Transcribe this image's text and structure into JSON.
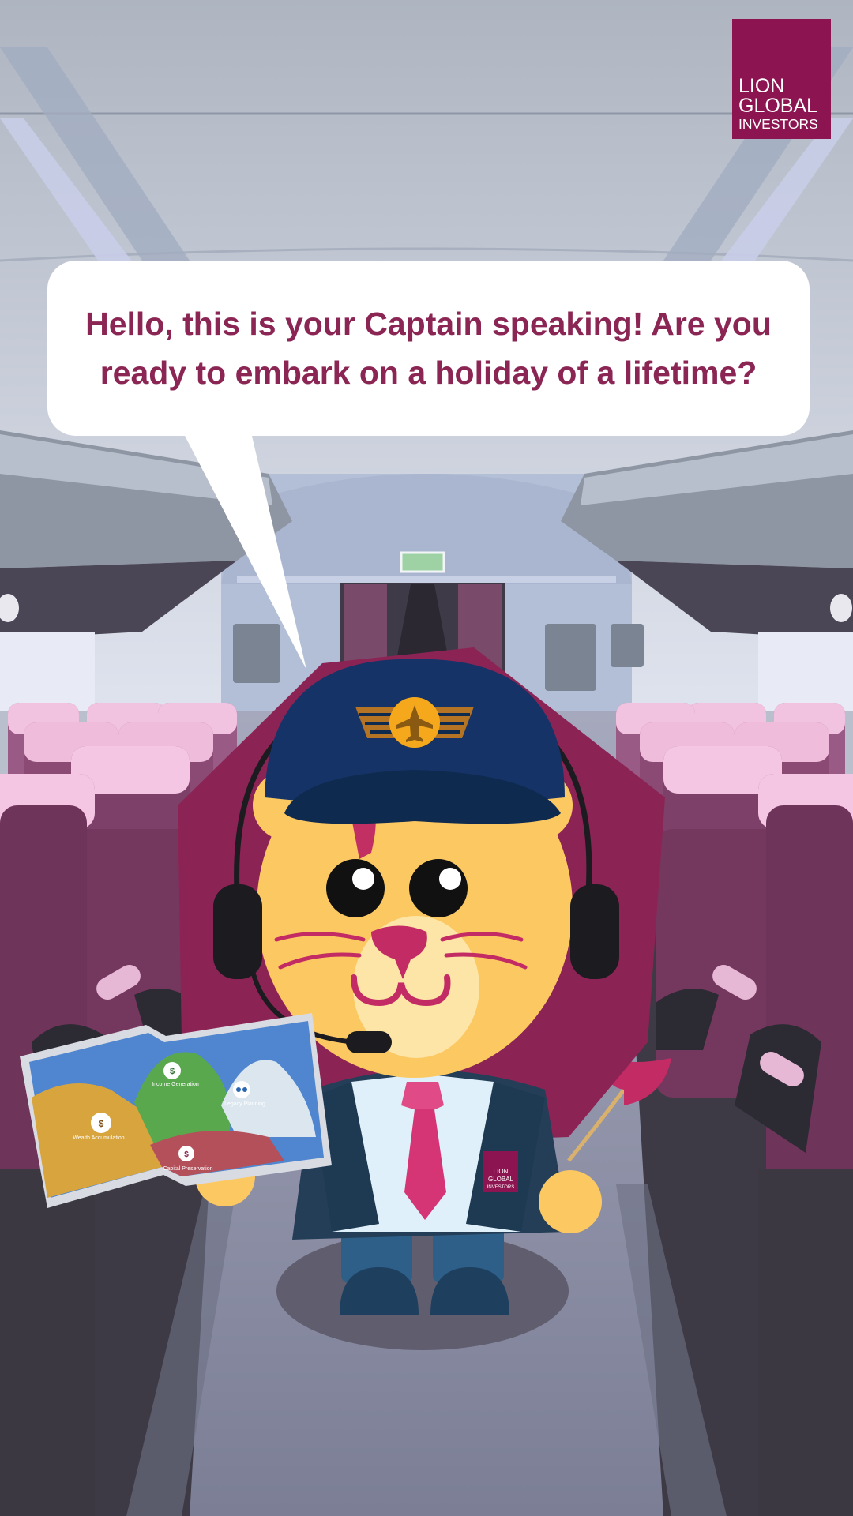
{
  "speech_bubble": {
    "text": "Hello, this is your Captain speaking! Are you ready to embark on a holiday of a lifetime?"
  },
  "logo": {
    "line1": "LION",
    "line2": "GLOBAL",
    "line3": "INVESTORS"
  },
  "map": {
    "regions": [
      "Wealth Accumulation",
      "Income Generation",
      "Legacy Planning",
      "Capital Preservation"
    ]
  },
  "colors": {
    "brand": "#8c1450",
    "bubble_text": "#8b2553",
    "lion_face": "#fcc862",
    "captain_hat": "#153366",
    "seat": "#8a4a74"
  },
  "icons": [
    "airplane-icon",
    "dollar-icon",
    "money-bag-icon",
    "family-icon",
    "safe-icon"
  ]
}
